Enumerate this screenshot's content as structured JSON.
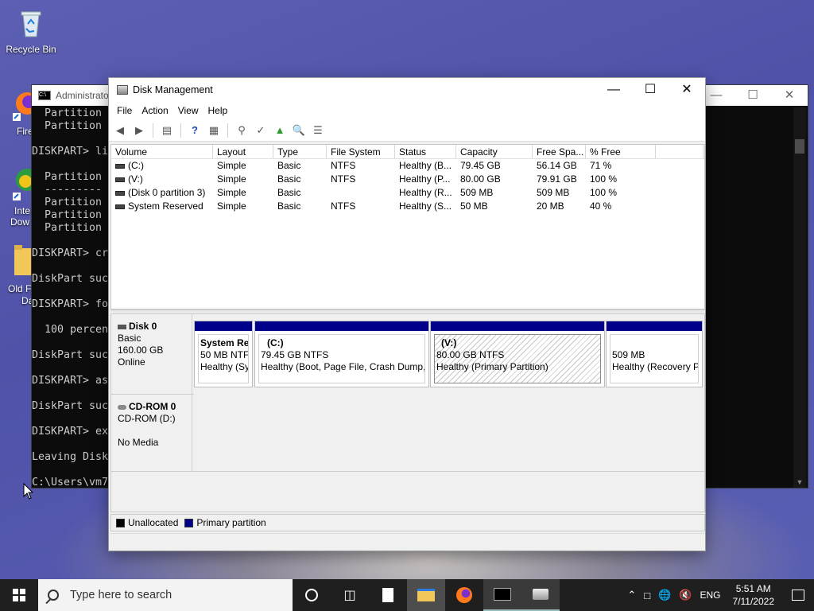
{
  "desktop": {
    "recycle_bin_label": "Recycle Bin",
    "firefox_partial": "Fire",
    "internet_download_partial_1": "Inte",
    "internet_download_partial_2": "Dow",
    "old_folder_partial_1": "Old F",
    "old_folder_partial_2": "Da"
  },
  "cmd": {
    "title": "Administrato",
    "lines": [
      "  Partition",
      "  Partition",
      "",
      "DISKPART> li",
      "",
      "  Partition",
      "  ---------",
      "  Partition",
      "  Partition",
      "  Partition",
      "",
      "DISKPART> cr",
      "",
      "DiskPart suc",
      "",
      "DISKPART> fo",
      "",
      "  100 percen",
      "",
      "DiskPart suc",
      "",
      "DISKPART> as",
      "",
      "DiskPart suc",
      "",
      "DISKPART> ex",
      "",
      "Leaving Disk",
      "",
      "C:\\Users\\vm7"
    ]
  },
  "disk_management": {
    "title": "Disk Management",
    "menu": [
      "File",
      "Action",
      "View",
      "Help"
    ],
    "columns": [
      "Volume",
      "Layout",
      "Type",
      "File System",
      "Status",
      "Capacity",
      "Free Spa...",
      "% Free",
      ""
    ],
    "volumes": [
      {
        "volume": "(C:)",
        "layout": "Simple",
        "type": "Basic",
        "fs": "NTFS",
        "status": "Healthy (B...",
        "capacity": "79.45 GB",
        "free": "56.14 GB",
        "pct": "71 %"
      },
      {
        "volume": "(V:)",
        "layout": "Simple",
        "type": "Basic",
        "fs": "NTFS",
        "status": "Healthy (P...",
        "capacity": "80.00 GB",
        "free": "79.91 GB",
        "pct": "100 %"
      },
      {
        "volume": "(Disk 0 partition 3)",
        "layout": "Simple",
        "type": "Basic",
        "fs": "",
        "status": "Healthy (R...",
        "capacity": "509 MB",
        "free": "509 MB",
        "pct": "100 %"
      },
      {
        "volume": "System Reserved",
        "layout": "Simple",
        "type": "Basic",
        "fs": "NTFS",
        "status": "Healthy (S...",
        "capacity": "50 MB",
        "free": "20 MB",
        "pct": "40 %"
      }
    ],
    "disk0": {
      "name": "Disk 0",
      "kind": "Basic",
      "size": "160.00 GB",
      "state": "Online",
      "partitions": [
        {
          "name": "System Re",
          "size": "50 MB NTFS",
          "status": "Healthy (Sy"
        },
        {
          "name": "(C:)",
          "size": "79.45 GB NTFS",
          "status": "Healthy (Boot, Page File, Crash Dump,"
        },
        {
          "name": "(V:)",
          "size": "80.00 GB NTFS",
          "status": "Healthy (Primary Partition)"
        },
        {
          "name": "",
          "size": "509 MB",
          "status": "Healthy (Recovery Pa"
        }
      ]
    },
    "cdrom0": {
      "name": "CD-ROM 0",
      "drive": "CD-ROM (D:)",
      "media": "No Media"
    },
    "legend": [
      {
        "label": "Unallocated",
        "color": "#000000"
      },
      {
        "label": "Primary partition",
        "color": "#00008b"
      }
    ]
  },
  "taskbar": {
    "search_placeholder": "Type here to search",
    "language": "ENG",
    "time": "5:51 AM",
    "date": "7/11/2022"
  }
}
